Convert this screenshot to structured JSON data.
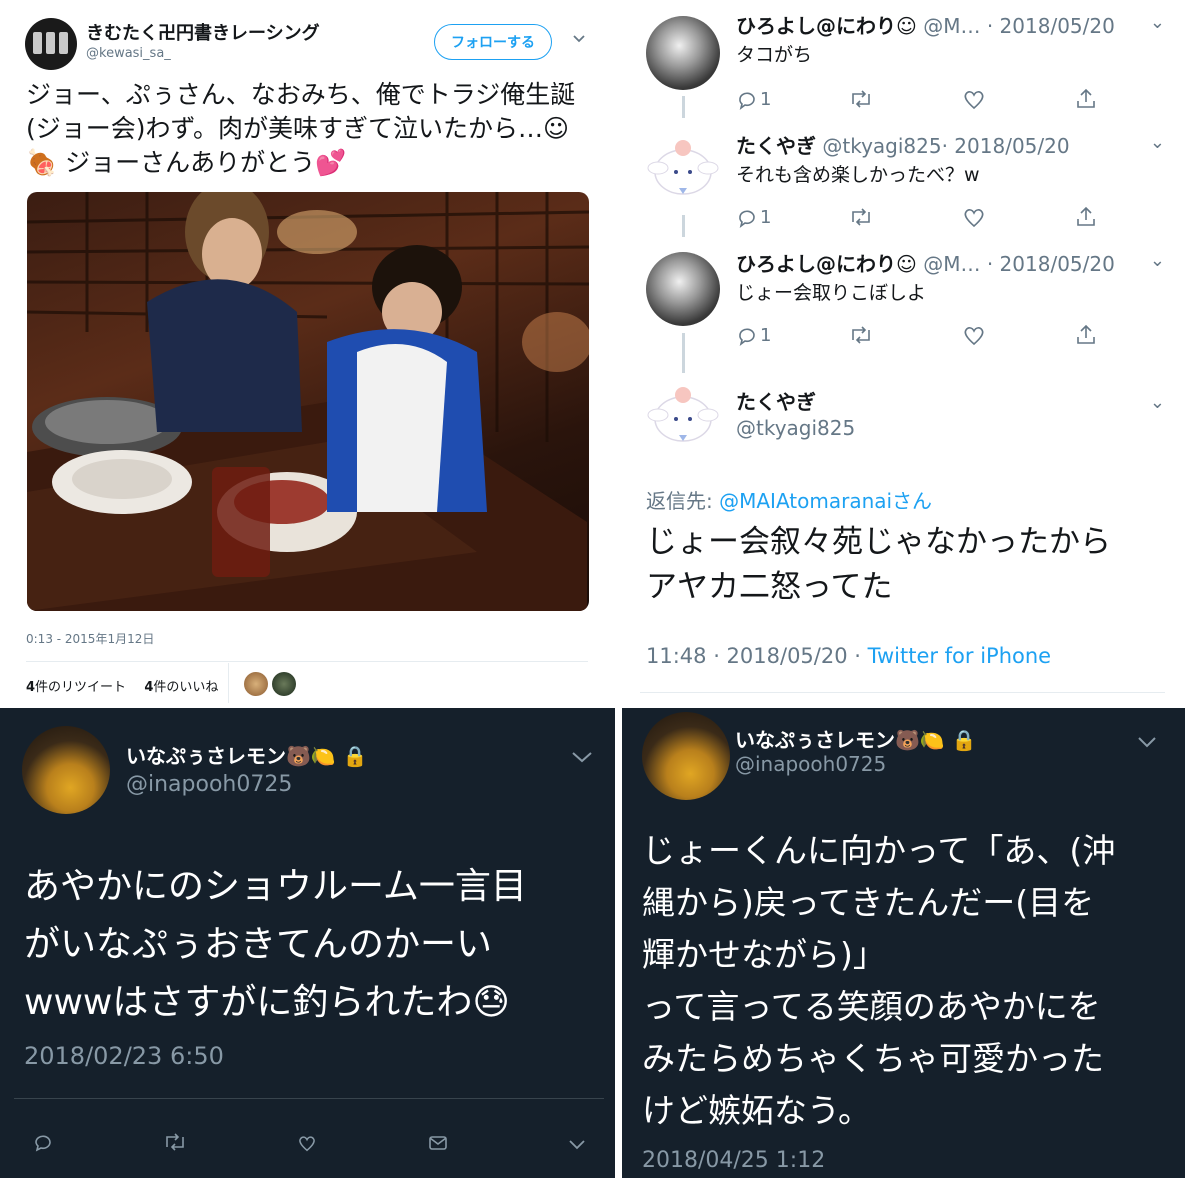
{
  "panel_a": {
    "display_name": "きむたく卍円書きレーシング",
    "handle": "@kewasi_sa_",
    "follow_label": "フォローする",
    "tweet_text": "ジョー、ぷぅさん、なおみち、俺でトラジ俺生誕(ジョー会)わず。肉が美味すぎて泣いたから…☺🍖 ジョーさんありがとう💕",
    "timestamp": "0:13 - 2015年1月12日",
    "retweet_count": "4",
    "retweet_label": "件のリツイート",
    "like_count": "4",
    "like_label": "件のいいね"
  },
  "panel_b": {
    "tweets": [
      {
        "name": "ひろよし@にわり☺",
        "handle": "@M…",
        "date": "· 2018/05/20",
        "text": "タコがち",
        "reply_count": "1"
      },
      {
        "name": "たくやぎ",
        "handle": "@tkyagi825",
        "date": "· 2018/05/20",
        "text": "それも含め楽しかったべ？w",
        "reply_count": "1"
      },
      {
        "name": "ひろよし@にわり☺",
        "handle": "@M…",
        "date": "· 2018/05/20",
        "text": "じょー会取りこぼしよ",
        "reply_count": "1"
      }
    ],
    "focus": {
      "name": "たくやぎ",
      "handle": "@tkyagi825",
      "reply_prefix": "返信先: ",
      "reply_to": "@MAIAtomaranaiさん",
      "text_line1": "じょー会叙々苑じゃなかったから",
      "text_line2": "アヤカ二怒ってた",
      "time": "11:48 · 2018/05/20 · ",
      "source": "Twitter for iPhone"
    }
  },
  "panel_c": {
    "display_name": "いなぷぅさレモン🐻🍋 🔒",
    "handle": "@inapooh0725",
    "text_line1": "あやかにのショウルーム一言目",
    "text_line2": "がいなぷぅおきてんのかーい",
    "text_line3": "wwwはさすがに釣られたわ😓",
    "date": "2018/02/23 6:50"
  },
  "panel_d": {
    "display_name": "いなぷぅさレモン🐻🍋 🔒",
    "handle": "@inapooh0725",
    "text_line1": "じょーくんに向かって「あ、(沖",
    "text_line2": "縄から)戻ってきたんだー(目を",
    "text_line3": "輝かせながら)」",
    "text_line4": "って言ってる笑顔のあやかにを",
    "text_line5": "みたらめちゃくちゃ可愛かった",
    "text_line6": "けど嫉妬なう。",
    "date": "2018/04/25 1:12"
  },
  "colors": {
    "accent": "#1da1f2",
    "dark_bg": "#15202b",
    "muted": "#657786"
  }
}
